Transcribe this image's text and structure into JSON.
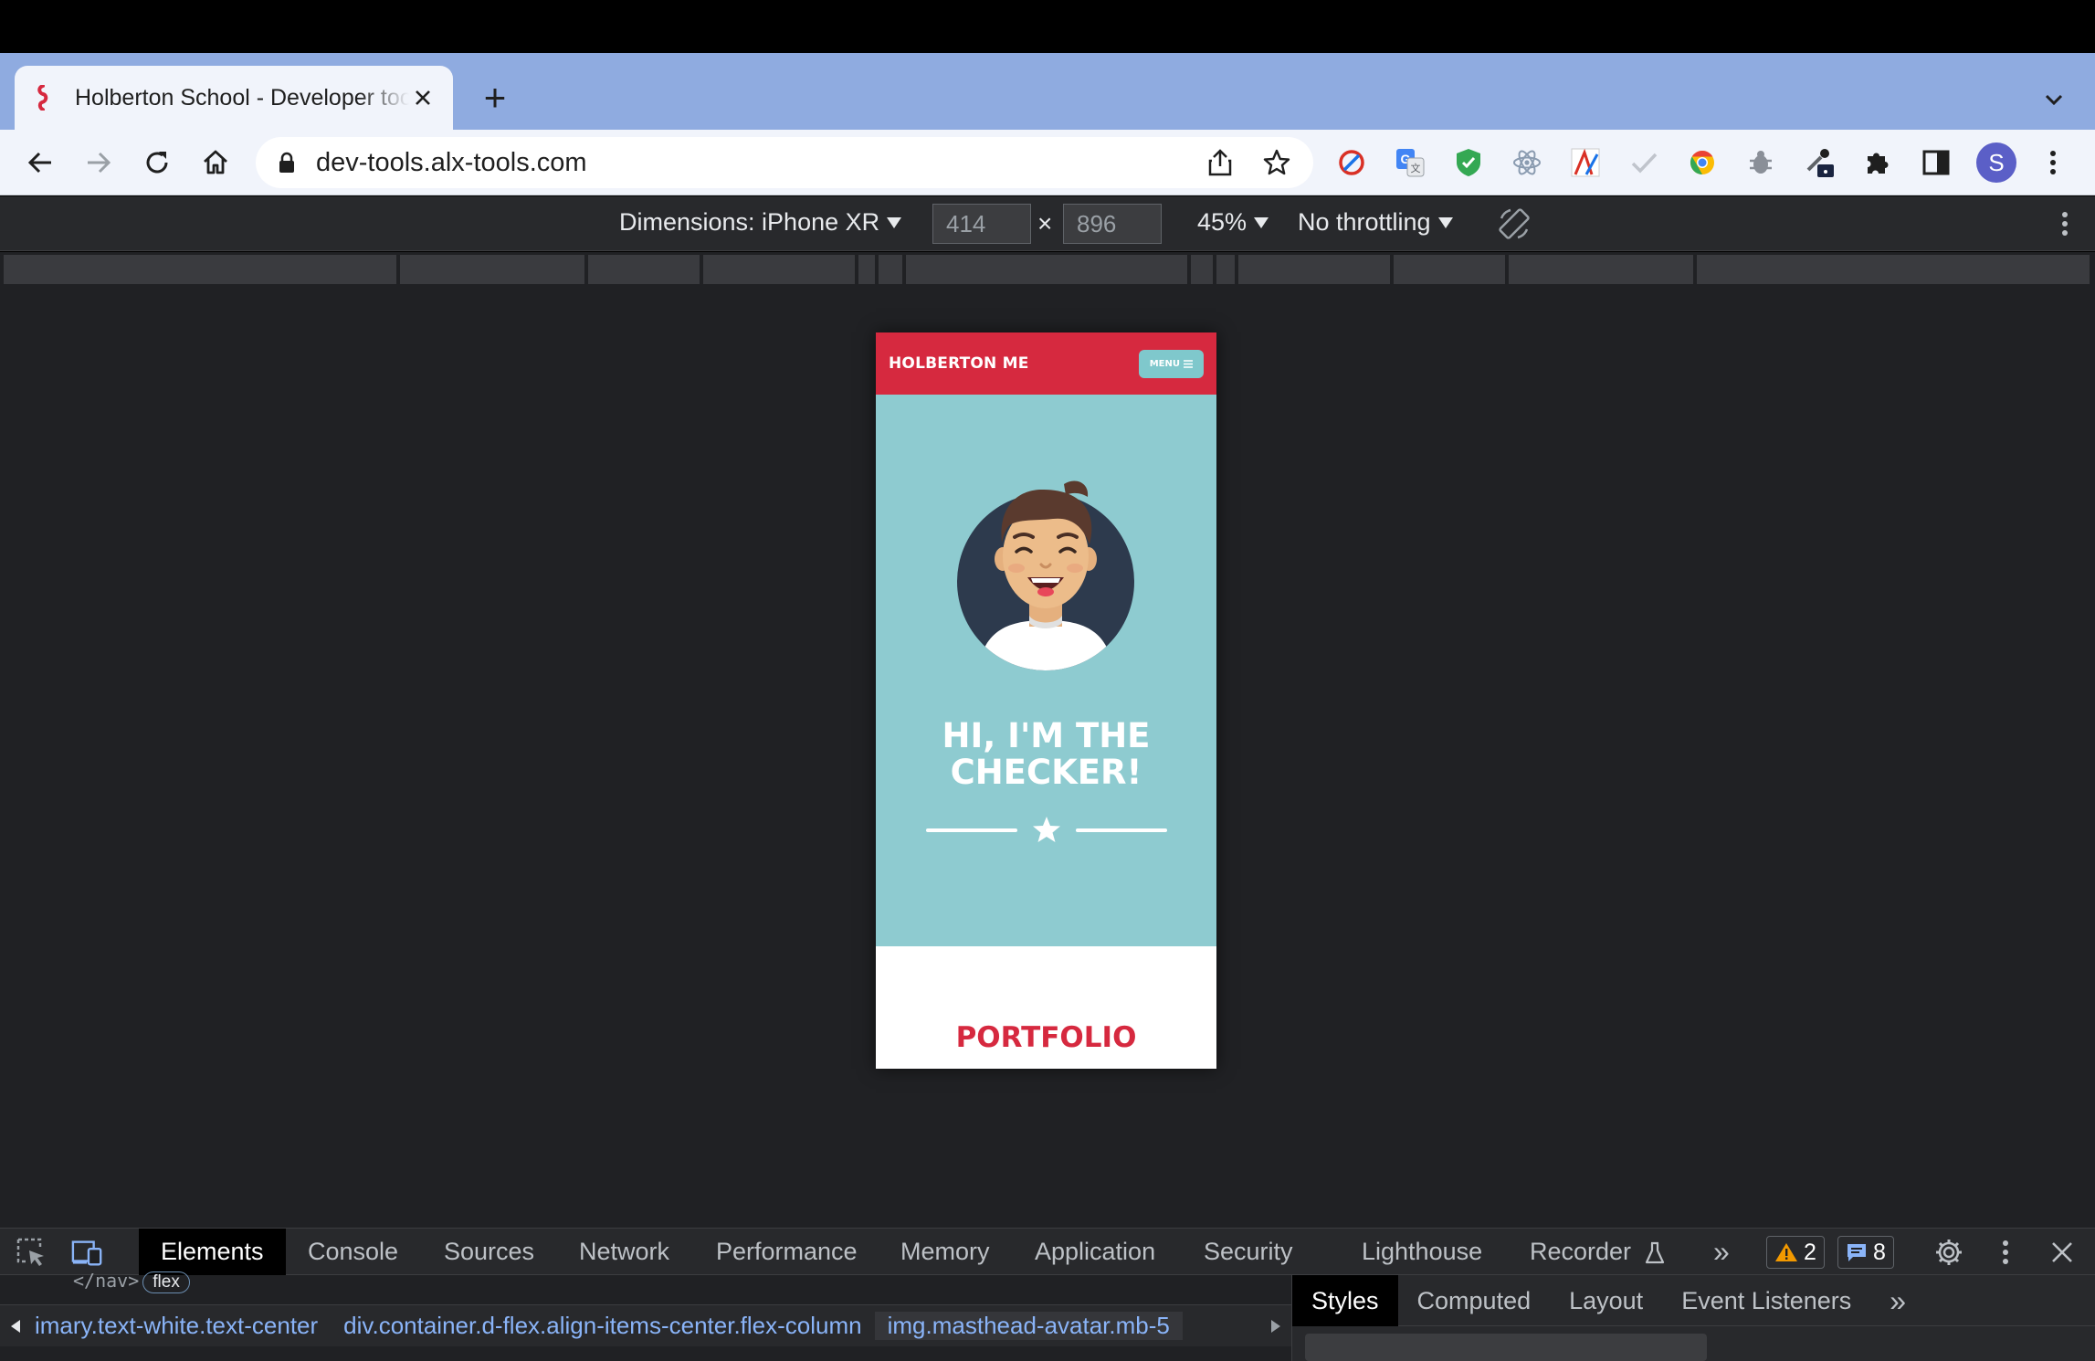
{
  "browser": {
    "tab_title": "Holberton School - Developer tools",
    "new_tab_label": "+",
    "url": "dev-tools.alx-tools.com",
    "profile_initial": "S",
    "extensions": [
      "ublock-icon",
      "google-translate-icon",
      "shield-extension-icon",
      "react-devtools-icon",
      "adobe-extension-icon",
      "check-extension-icon",
      "chrome-extension-icon",
      "bug-extension-icon",
      "eyedropper-extension-icon",
      "puzzle-extensions-icon",
      "side-panel-icon"
    ]
  },
  "device_toolbar": {
    "dimensions_label": "Dimensions: iPhone XR",
    "width": "414",
    "height": "896",
    "times": "×",
    "zoom": "45%",
    "throttling": "No throttling"
  },
  "site": {
    "brand": "HOLBERTON ME",
    "menu_label": "MENU",
    "heading": "HI, I'M THE CHECKER!",
    "portfolio_heading": "PORTFOLIO"
  },
  "devtools": {
    "tabs": [
      "Elements",
      "Console",
      "Sources",
      "Network",
      "Performance",
      "Memory",
      "Application",
      "Security",
      "Lighthouse",
      "Recorder"
    ],
    "more_tabs": "»",
    "warnings_count": "2",
    "messages_count": "8",
    "dom_snippet": "</nav>",
    "flex_badge": "flex",
    "breadcrumbs": {
      "first": "imary.text-white.text-center",
      "second_tag": "div",
      "second_cls": ".container.d-flex.align-items-center.flex-column",
      "third_tag": "img",
      "third_cls": ".masthead-avatar.mb-5"
    },
    "styles_tabs": [
      "Styles",
      "Computed",
      "Layout",
      "Event Listeners"
    ],
    "styles_more": "»"
  },
  "colors": {
    "nav_red": "#d6293f",
    "masthead_teal": "#8ecbd0",
    "menu_button": "#7fc8cc"
  }
}
